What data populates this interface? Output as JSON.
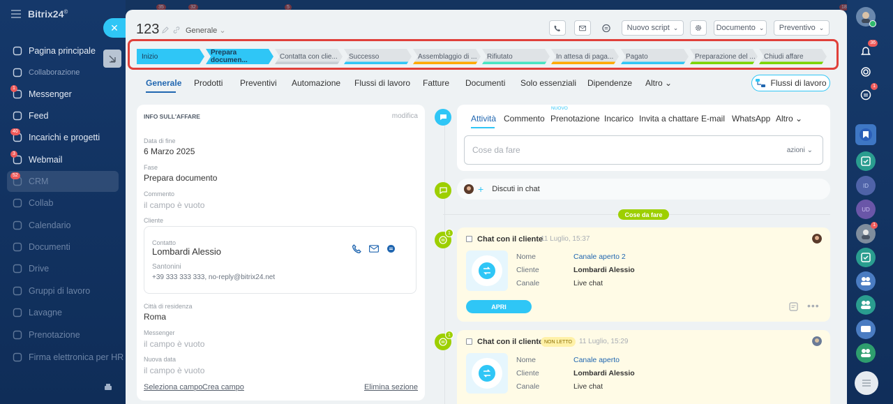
{
  "app": {
    "brand": "Bitrix24",
    "brand_mark": "©"
  },
  "top_counters": [
    "35",
    "32",
    "5",
    "18"
  ],
  "sidebar": {
    "items": [
      {
        "label": "Pagina principale",
        "icon": "home-icon",
        "badge": ""
      },
      {
        "label": "Collaborazione",
        "icon": "collab-icon",
        "badge": ""
      },
      {
        "label": "Messenger",
        "icon": "chat-icon",
        "badge": "1"
      },
      {
        "label": "Feed",
        "icon": "feed-icon",
        "badge": ""
      },
      {
        "label": "Incarichi e progetti",
        "icon": "tasks-icon",
        "badge": "40"
      },
      {
        "label": "Webmail",
        "icon": "mail-icon",
        "badge": "3"
      },
      {
        "label": "CRM",
        "icon": "crm-icon",
        "badge": "52"
      },
      {
        "label": "Collab",
        "icon": "collab-circle-icon",
        "badge": ""
      },
      {
        "label": "Calendario",
        "icon": "calendar-icon",
        "badge": ""
      },
      {
        "label": "Documenti",
        "icon": "docs-icon",
        "badge": ""
      },
      {
        "label": "Drive",
        "icon": "drive-icon",
        "badge": ""
      },
      {
        "label": "Gruppi di lavoro",
        "icon": "groups-icon",
        "badge": ""
      },
      {
        "label": "Lavagne",
        "icon": "boards-icon",
        "badge": ""
      },
      {
        "label": "Prenotazione",
        "icon": "booking-icon",
        "badge": ""
      },
      {
        "label": "Firma elettronica per HR",
        "icon": "sign-icon",
        "badge": ""
      }
    ]
  },
  "right_badges": {
    "bell": "36",
    "chat": "1",
    "avatar": "1"
  },
  "deal": {
    "title": "123",
    "pipeline": "Generale"
  },
  "header_buttons": {
    "script": "Nuovo script",
    "document": "Documento",
    "quote": "Preventivo"
  },
  "stages": [
    {
      "label": "Inizio",
      "color": "#2fc6f6",
      "active": true
    },
    {
      "label": "Prepara documen...",
      "color": "#2fc6f6",
      "active": true
    },
    {
      "label": "Contatta con clie...",
      "color": "#c6cdd3",
      "active": false
    },
    {
      "label": "Successo",
      "color": "#2fc6f6",
      "active": false
    },
    {
      "label": "Assemblaggio di ...",
      "color": "#ffa900",
      "active": false
    },
    {
      "label": "Rifiutato",
      "color": "#47e4c2",
      "active": false
    },
    {
      "label": "In attesa di paga...",
      "color": "#ffa900",
      "active": false
    },
    {
      "label": "Pagato",
      "color": "#2fc6f6",
      "active": false
    },
    {
      "label": "Preparazione del ...",
      "color": "#7bd500",
      "active": false
    },
    {
      "label": "Chiudi affare",
      "color": "#7bd500",
      "active": false
    }
  ],
  "tabs": [
    "Generale",
    "Prodotti",
    "Preventivi",
    "Automazione",
    "Flussi di lavoro",
    "Fatture",
    "Documenti",
    "Solo essenziali",
    "Dipendenze",
    "Altro"
  ],
  "workflow_button": "Flussi di lavoro",
  "info": {
    "section_title": "INFO SULL'AFFARE",
    "edit": "modifica",
    "end_date_label": "Data di fine",
    "end_date": "6 Marzo 2025",
    "stage_label": "Fase",
    "stage": "Prepara documento",
    "comment_label": "Commento",
    "empty": "il campo è vuoto",
    "client_label": "Cliente",
    "contact_label": "Contatto",
    "contact_name": "Lombardi Alessio",
    "company": "Santonini",
    "contact_details": "+39 333 333 333, no-reply@bitrix24.net",
    "city_label": "Città di residenza",
    "city": "Roma",
    "messenger_label": "Messenger",
    "new_date_label": "Nuova data",
    "select_field": "Seleziona campo",
    "create_field": "Crea campo",
    "delete_section": "Elimina sezione"
  },
  "activity": {
    "tabs": [
      "Attività",
      "Commento",
      "Prenotazione",
      "Incarico",
      "Invita a chattare",
      "E-mail",
      "WhatsApp",
      "Altro"
    ],
    "new_badge": "NUOVO",
    "todo_placeholder": "Cose da fare",
    "actions": "azioni"
  },
  "discuss": "Discuti in chat",
  "todo_divider": "Cose da fare",
  "chat_cards": [
    {
      "title": "Chat con il cliente",
      "date": "11 Luglio, 15:37",
      "badge": "",
      "labels": [
        "Nome",
        "Cliente",
        "Canale"
      ],
      "values": [
        "Canale aperto 2",
        "Lombardi Alessio",
        "Live chat"
      ],
      "button": "APRI"
    },
    {
      "title": "Chat con il cliente",
      "date": "11 Luglio, 15:29",
      "badge": "NON LETTO",
      "labels": [
        "Nome",
        "Cliente",
        "Canale"
      ],
      "values": [
        "Canale aperto",
        "Lombardi Alessio",
        "Live chat"
      ],
      "button": ""
    }
  ],
  "colors": {
    "accent": "#2fc6f6",
    "link": "#2066b0",
    "highlight": "#e0403a",
    "green": "#9dcf00"
  }
}
